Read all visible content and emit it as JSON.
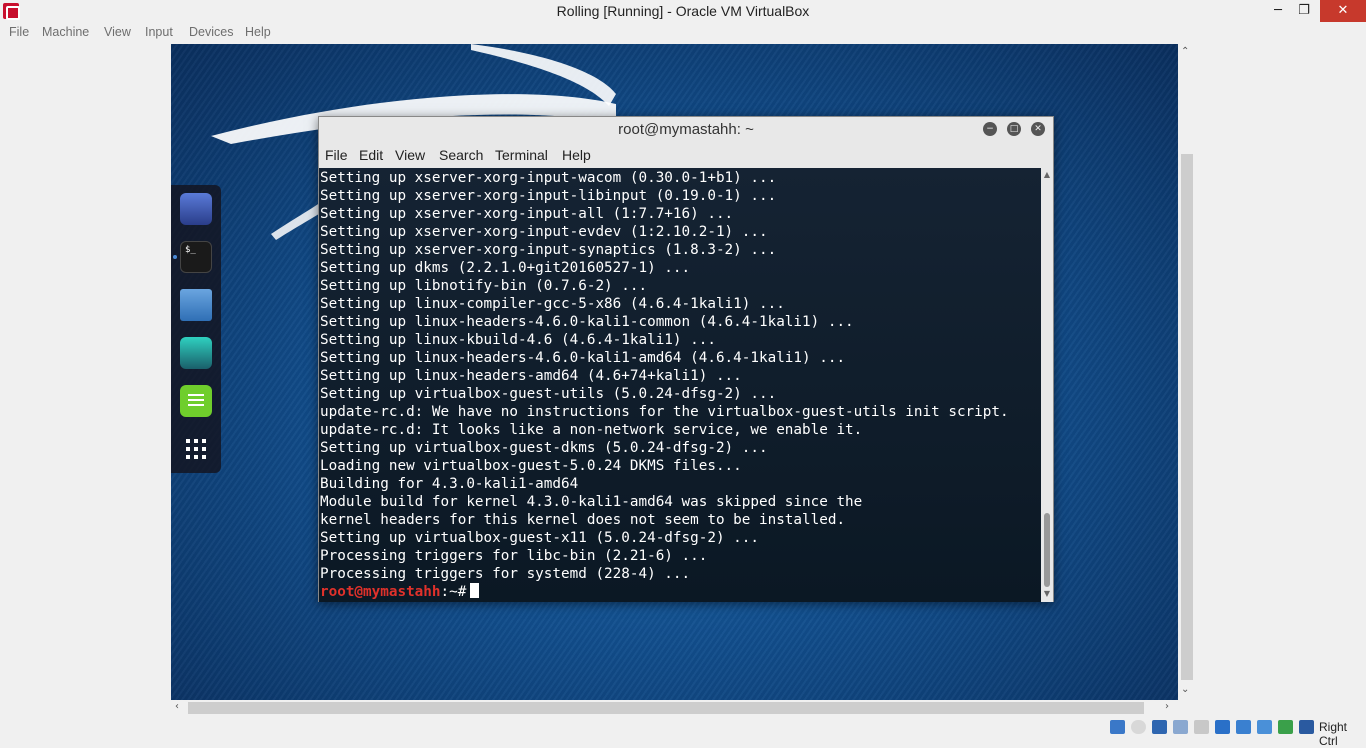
{
  "host": {
    "title": "Rolling [Running] - Oracle VM VirtualBox",
    "controls": {
      "minimize": "─",
      "restore": "❐",
      "close": "✕"
    },
    "menu": [
      "File",
      "Machine",
      "View",
      "Input",
      "Devices",
      "Help"
    ],
    "host_key": "Right Ctrl"
  },
  "dock": {
    "items": [
      "browser-icon",
      "terminal-icon",
      "files-icon",
      "avatar-icon",
      "notes-icon",
      "apps-grid-icon"
    ],
    "terminal_glyph": "$_"
  },
  "terminal": {
    "title": "root@mymastahh: ~",
    "menu": [
      "File",
      "Edit",
      "View",
      "Search",
      "Terminal",
      "Help"
    ],
    "lines": [
      "Setting up xserver-xorg-input-wacom (0.30.0-1+b1) ...",
      "Setting up xserver-xorg-input-libinput (0.19.0-1) ...",
      "Setting up xserver-xorg-input-all (1:7.7+16) ...",
      "Setting up xserver-xorg-input-evdev (1:2.10.2-1) ...",
      "Setting up xserver-xorg-input-synaptics (1.8.3-2) ...",
      "Setting up dkms (2.2.1.0+git20160527-1) ...",
      "Setting up libnotify-bin (0.7.6-2) ...",
      "Setting up linux-compiler-gcc-5-x86 (4.6.4-1kali1) ...",
      "Setting up linux-headers-4.6.0-kali1-common (4.6.4-1kali1) ...",
      "Setting up linux-kbuild-4.6 (4.6.4-1kali1) ...",
      "Setting up linux-headers-4.6.0-kali1-amd64 (4.6.4-1kali1) ...",
      "Setting up linux-headers-amd64 (4.6+74+kali1) ...",
      "Setting up virtualbox-guest-utils (5.0.24-dfsg-2) ...",
      "update-rc.d: We have no instructions for the virtualbox-guest-utils init script.",
      "update-rc.d: It looks like a non-network service, we enable it.",
      "Setting up virtualbox-guest-dkms (5.0.24-dfsg-2) ...",
      "Loading new virtualbox-guest-5.0.24 DKMS files...",
      "Building for 4.3.0-kali1-amd64",
      "Module build for kernel 4.3.0-kali1-amd64 was skipped since the",
      "kernel headers for this kernel does not seem to be installed.",
      "Setting up virtualbox-guest-x11 (5.0.24-dfsg-2) ...",
      "Processing triggers for libc-bin (2.21-6) ...",
      "Processing triggers for systemd (228-4) ..."
    ],
    "prompt_user": "root@mymastahh",
    "prompt_path": ":~#"
  },
  "colors": {
    "prompt": "#e0312b",
    "close_button": "#c7392c",
    "desktop": "#124f8e"
  }
}
